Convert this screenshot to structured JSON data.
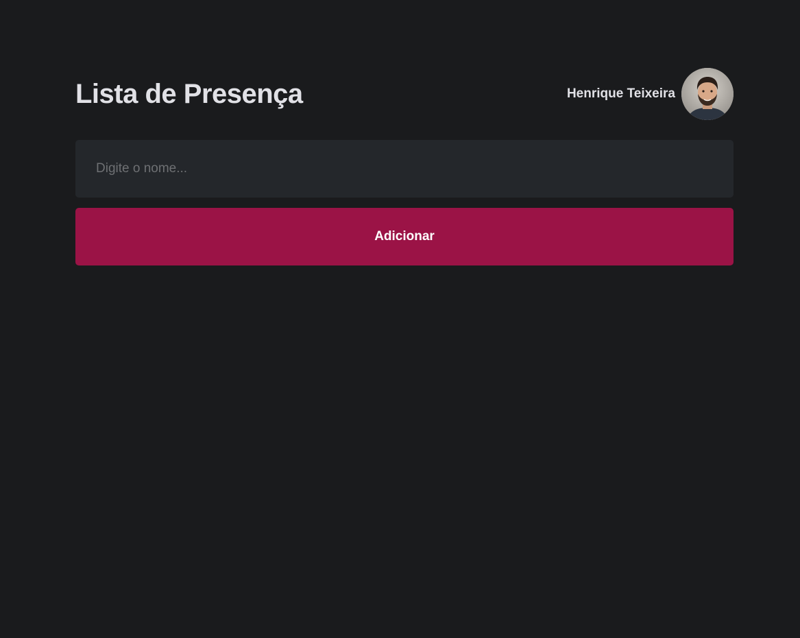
{
  "header": {
    "title": "Lista de Presença",
    "user": {
      "name": "Henrique Teixeira",
      "avatar_icon": "user-avatar-photo"
    }
  },
  "form": {
    "input_placeholder": "Digite o nome...",
    "input_value": "",
    "add_button_label": "Adicionar"
  },
  "colors": {
    "background": "#1a1b1d",
    "input_background": "#24272b",
    "accent": "#9b1346",
    "text": "#e1e1e6",
    "placeholder": "#6e7073"
  }
}
